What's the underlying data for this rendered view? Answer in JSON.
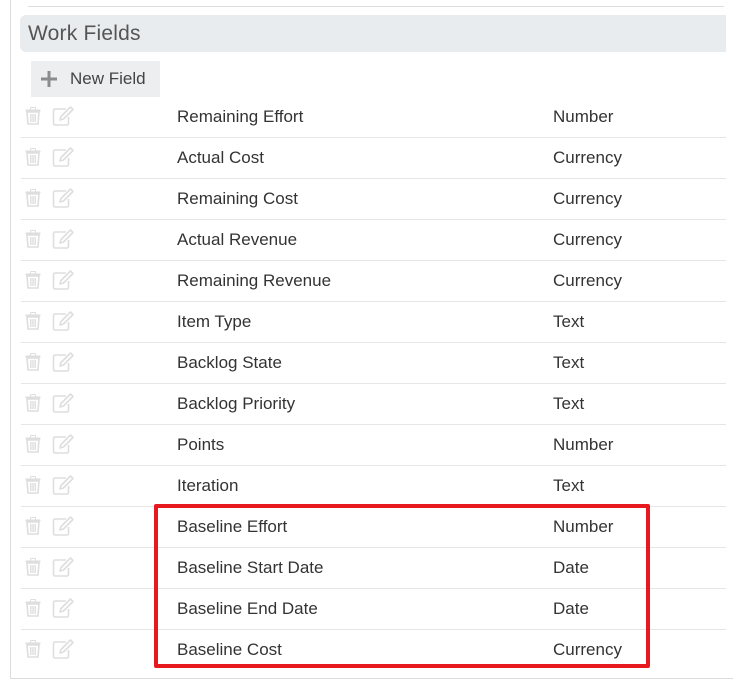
{
  "section": {
    "title": "Work Fields"
  },
  "toolbar": {
    "new_field_label": "New Field"
  },
  "icons": {
    "delete": "trash-icon",
    "edit": "edit-icon",
    "add": "plus-icon"
  },
  "colors": {
    "icon": "#dcdcdc",
    "highlight": "#e8191e",
    "header_bg": "#e9ecef"
  },
  "fields": [
    {
      "name": "Remaining Effort",
      "type": "Number"
    },
    {
      "name": "Actual Cost",
      "type": "Currency"
    },
    {
      "name": "Remaining Cost",
      "type": "Currency"
    },
    {
      "name": "Actual Revenue",
      "type": "Currency"
    },
    {
      "name": "Remaining Revenue",
      "type": "Currency"
    },
    {
      "name": "Item Type",
      "type": "Text"
    },
    {
      "name": "Backlog State",
      "type": "Text"
    },
    {
      "name": "Backlog Priority",
      "type": "Text"
    },
    {
      "name": "Points",
      "type": "Number"
    },
    {
      "name": "Iteration",
      "type": "Text"
    },
    {
      "name": "Baseline Effort",
      "type": "Number"
    },
    {
      "name": "Baseline Start Date",
      "type": "Date"
    },
    {
      "name": "Baseline End Date",
      "type": "Date"
    },
    {
      "name": "Baseline Cost",
      "type": "Currency"
    }
  ]
}
